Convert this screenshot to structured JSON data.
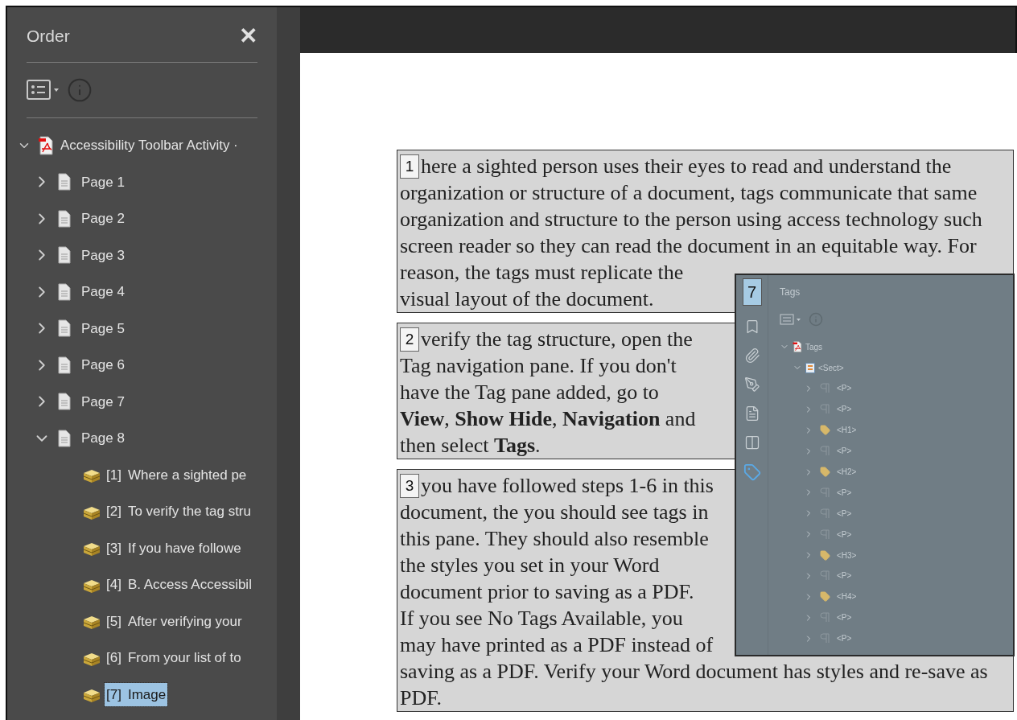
{
  "order_panel": {
    "title": "Order",
    "close": "✕",
    "tree": [
      {
        "label": "Accessibility Toolbar Activity ·",
        "kind": "document",
        "expanded": true,
        "children": [
          {
            "label": "Page 1",
            "kind": "page",
            "expanded": false
          },
          {
            "label": "Page 2",
            "kind": "page",
            "expanded": false
          },
          {
            "label": "Page 3",
            "kind": "page",
            "expanded": false
          },
          {
            "label": "Page 4",
            "kind": "page",
            "expanded": false
          },
          {
            "label": "Page 5",
            "kind": "page",
            "expanded": false
          },
          {
            "label": "Page 6",
            "kind": "page",
            "expanded": false
          },
          {
            "label": "Page 7",
            "kind": "page",
            "expanded": false
          },
          {
            "label": "Page 8",
            "kind": "page",
            "expanded": true,
            "children": [
              {
                "index": "[1]",
                "label": "Where a sighted pe",
                "kind": "container",
                "selected": false
              },
              {
                "index": "[2]",
                "label": "To verify the tag stru",
                "kind": "container",
                "selected": false
              },
              {
                "index": "[3]",
                "label": "If you have followe",
                "kind": "container",
                "selected": false
              },
              {
                "index": "[4]",
                "label": "B. Access Accessibil",
                "kind": "container",
                "selected": false
              },
              {
                "index": "[5]",
                "label": "After verifying your",
                "kind": "container",
                "selected": false
              },
              {
                "index": "[6]",
                "label": "From your list of to",
                "kind": "container",
                "selected": false
              },
              {
                "index": "[7]",
                "label": "Image",
                "kind": "container",
                "selected": true
              }
            ]
          }
        ]
      }
    ]
  },
  "document": {
    "blocks": [
      {
        "number": "1",
        "lines": [
          "here a sighted person uses their eyes to read and understand the",
          "organization or structure of a document, tags communicate that same",
          "organization and structure to the person using access technology such",
          "screen reader so they can read the document in an equitable way. For",
          "reason, the tags must replicate the",
          "visual layout of the document."
        ]
      },
      {
        "number": "2",
        "lines": [
          "verify the tag structure, open the",
          "Tag navigation pane. If you don't",
          "have the Tag pane added, go to",
          "**View**, **Show Hide**, **Navigation** and",
          "then select **Tags**."
        ]
      },
      {
        "number": "3",
        "lines": [
          "you have followed steps 1-6 in this",
          "document, the you should see tags in",
          "this pane. They should also resemble",
          "the styles you set in your Word",
          "document prior to saving as a PDF.",
          "If you see No Tags Available, you",
          "may have printed as a PDF instead of",
          "saving as a PDF. Verify your Word document has styles and re-save as",
          "PDF."
        ]
      }
    ],
    "image": {
      "number": "7",
      "tags_pane": {
        "title": "Tags",
        "root": "Tags",
        "section": "<Sect>",
        "items": [
          {
            "label": "<P>",
            "kind": "paragraph"
          },
          {
            "label": "<P>",
            "kind": "paragraph"
          },
          {
            "label": "<H1>",
            "kind": "heading"
          },
          {
            "label": "<P>",
            "kind": "paragraph"
          },
          {
            "label": "<H2>",
            "kind": "heading"
          },
          {
            "label": "<P>",
            "kind": "paragraph"
          },
          {
            "label": "<P>",
            "kind": "paragraph"
          },
          {
            "label": "<P>",
            "kind": "paragraph"
          },
          {
            "label": "<H3>",
            "kind": "heading"
          },
          {
            "label": "<P>",
            "kind": "paragraph"
          },
          {
            "label": "<H4>",
            "kind": "heading"
          },
          {
            "label": "<P>",
            "kind": "paragraph"
          },
          {
            "label": "<P>",
            "kind": "paragraph"
          }
        ]
      }
    }
  }
}
